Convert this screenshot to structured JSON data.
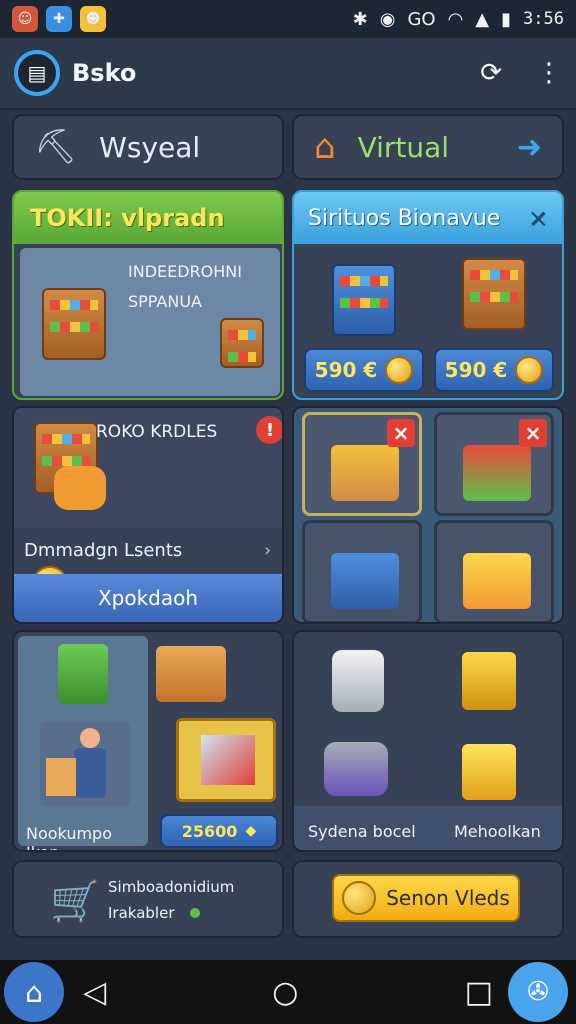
{
  "status": {
    "time": "3:56",
    "network": "GO"
  },
  "app": {
    "title": "Bsko"
  },
  "tabs": [
    {
      "label": "Wsyeal"
    },
    {
      "label": "Virtual"
    }
  ],
  "promo_panel": {
    "title": "TOKII: vlpradn",
    "line1": "INDEEDROHNI",
    "line2": "SPPANUA"
  },
  "shop_panel": {
    "title": "Sirituos Bionavue",
    "close": "×",
    "prices": [
      "590 €",
      "590 €"
    ]
  },
  "quest_panel": {
    "title": "ROKO KRDLES",
    "badge": "!",
    "row_label": "Dmmadgn Lsents",
    "button": "Xpokdaoh"
  },
  "items": {
    "left_label": "Nookumpo Ikon",
    "price": "25600",
    "right_labels": [
      "Sydena bocel",
      "Mehoolkan"
    ]
  },
  "footer": {
    "left_text_1": "Simboadonidium",
    "left_text_2": "Irakabler",
    "button": "Senon Vleds"
  },
  "colors": {
    "accent": "#3aa6f0",
    "coin": "#f1ad12",
    "panel": "#374257"
  }
}
